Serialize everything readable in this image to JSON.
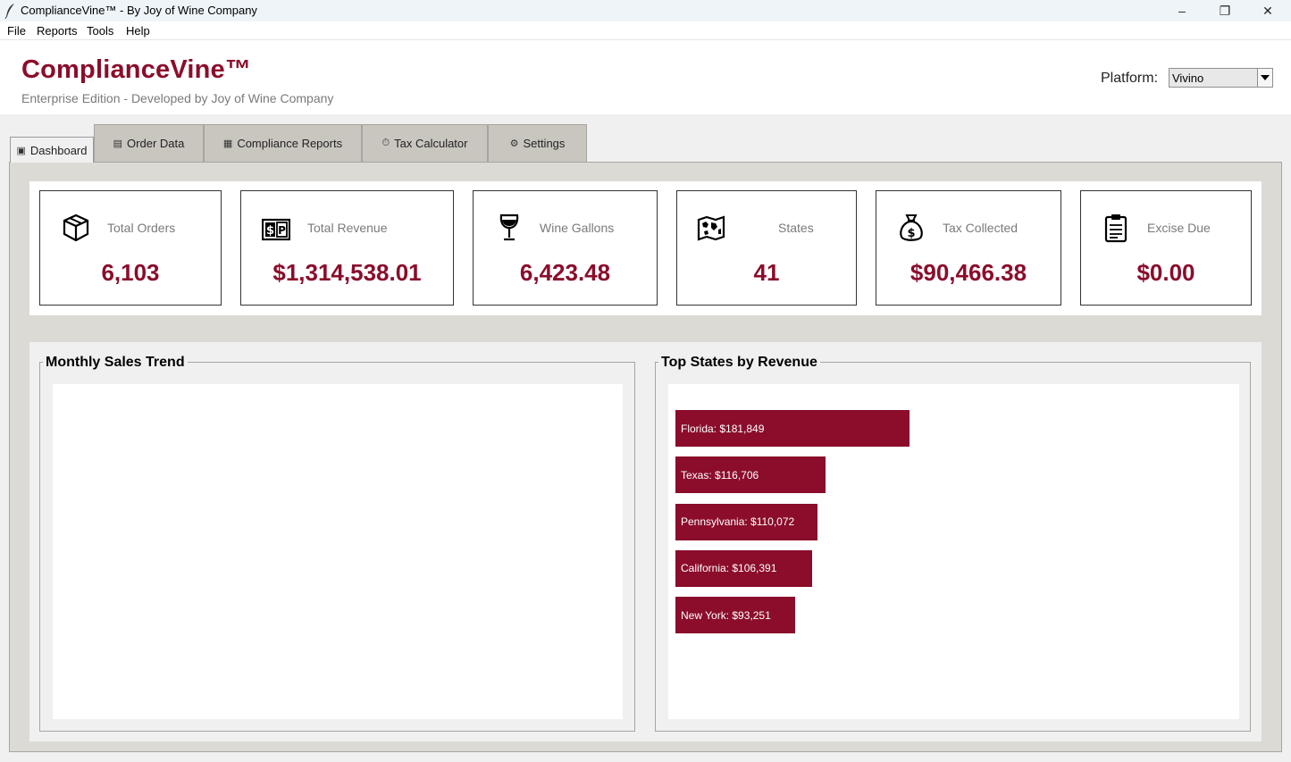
{
  "window": {
    "title": "ComplianceVine™ - By Joy of Wine Company",
    "minimize_glyph": "–",
    "maximize_glyph": "❐",
    "close_glyph": "✕"
  },
  "menu": [
    "File",
    "Reports",
    "Tools",
    "Help"
  ],
  "header": {
    "brand": "ComplianceVine™",
    "subtitle": "Enterprise Edition - Developed by Joy of Wine Company",
    "platform_label": "Platform:",
    "platform_value": "Vivino"
  },
  "tabs": [
    {
      "label": "Dashboard",
      "icon": "dashboard-icon",
      "glyph": "▣",
      "active": true
    },
    {
      "label": "Order Data",
      "icon": "order-data-icon",
      "glyph": "▤",
      "active": false
    },
    {
      "label": "Compliance Reports",
      "icon": "report-icon",
      "glyph": "▦",
      "active": false
    },
    {
      "label": "Tax Calculator",
      "icon": "stopwatch-icon",
      "glyph": "⏱",
      "active": false
    },
    {
      "label": "Settings",
      "icon": "gear-icon",
      "glyph": "⚙",
      "active": false
    }
  ],
  "cards": [
    {
      "label": "Total Orders",
      "value": "6,103",
      "icon": "package-icon"
    },
    {
      "label": "Total Revenue",
      "value": "$1,314,538.01",
      "icon": "cash-register-icon"
    },
    {
      "label": "Wine Gallons",
      "value": "6,423.48",
      "icon": "wine-glass-icon"
    },
    {
      "label": "States",
      "value": "41",
      "icon": "map-icon"
    },
    {
      "label": "Tax Collected",
      "value": "$90,466.38",
      "icon": "money-bag-icon"
    },
    {
      "label": "Excise Due",
      "value": "$0.00",
      "icon": "clipboard-icon"
    }
  ],
  "panels": {
    "monthly_title": "Monthly Sales Trend",
    "states_title": "Top States by Revenue"
  },
  "top_states": [
    {
      "label": "Florida: $181,849",
      "value": 181849
    },
    {
      "label": "Texas: $116,706",
      "value": 116706
    },
    {
      "label": "Pennsylvania: $110,072",
      "value": 110072
    },
    {
      "label": "California: $106,391",
      "value": 106391
    },
    {
      "label": "New York: $93,251",
      "value": 93251
    }
  ],
  "colors": {
    "accent": "#8b0d2b"
  }
}
